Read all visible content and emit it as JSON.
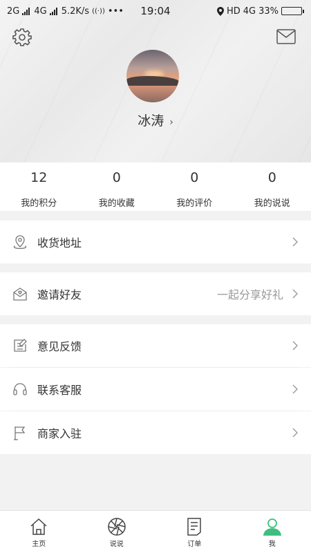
{
  "status_bar": {
    "network_1": "2G",
    "network_2": "4G",
    "speed": "5.2K/s",
    "dots": "•••",
    "time": "19:04",
    "hd": "HD",
    "network_3": "4G",
    "battery": "33%",
    "battery_level": 0.33
  },
  "profile": {
    "username": "冰涛",
    "chevron": "›"
  },
  "stats": [
    {
      "value": "12",
      "label": "我的积分"
    },
    {
      "value": "0",
      "label": "我的收藏"
    },
    {
      "value": "0",
      "label": "我的评价"
    },
    {
      "value": "0",
      "label": "我的说说"
    }
  ],
  "menu": {
    "address": "收货地址",
    "invite": "邀请好友",
    "invite_hint": "一起分享好礼",
    "feedback": "意见反馈",
    "service": "联系客服",
    "merchant": "商家入驻"
  },
  "tabs": [
    {
      "label": "主页"
    },
    {
      "label": "说说"
    },
    {
      "label": "订单"
    },
    {
      "label": "我"
    }
  ],
  "colors": {
    "accent": "#3fbf7f"
  }
}
